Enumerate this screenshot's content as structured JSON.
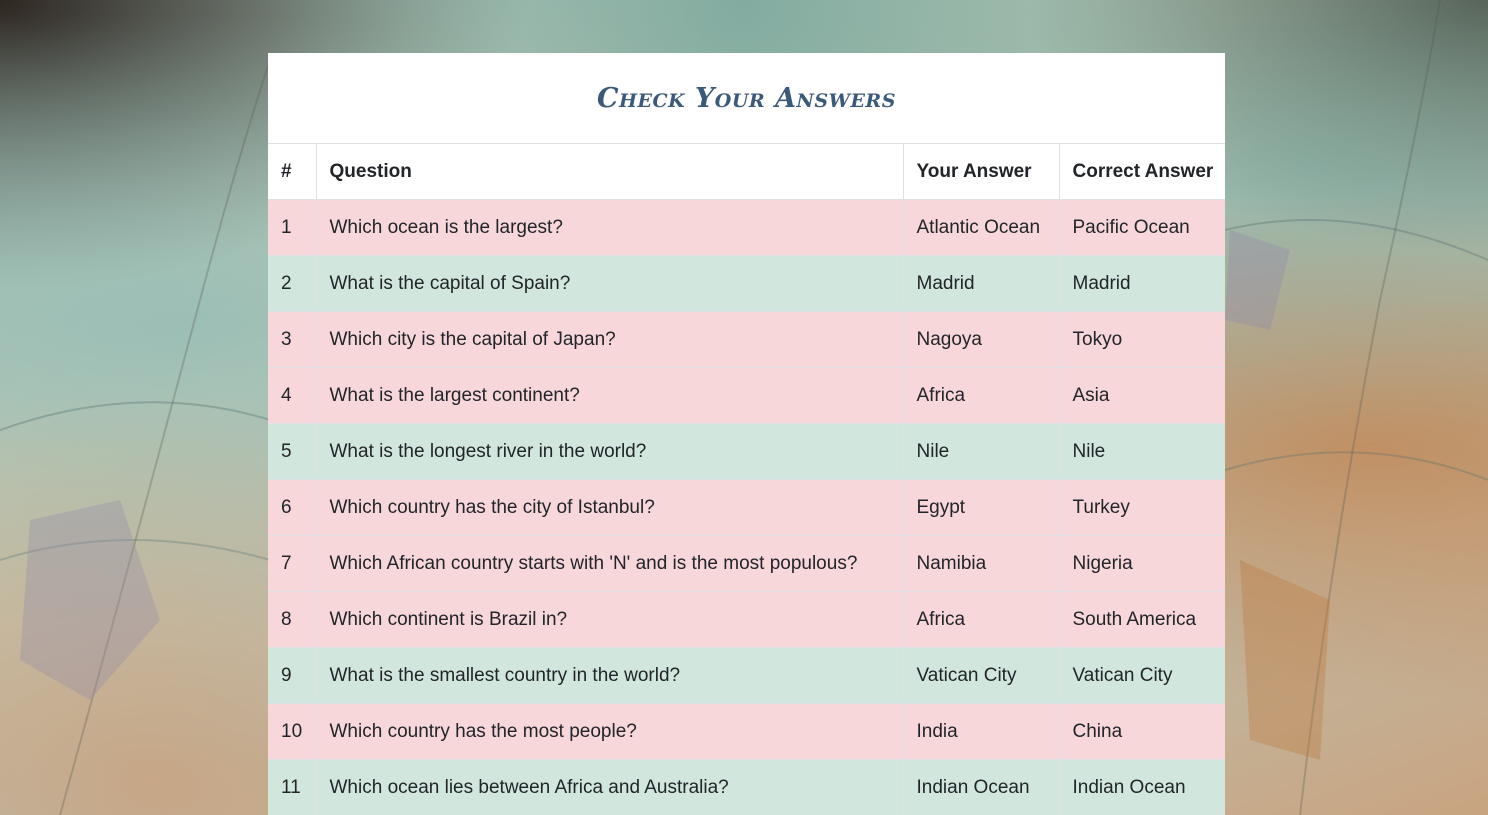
{
  "page": {
    "title": "Check Your Answers"
  },
  "table": {
    "headers": {
      "num": "#",
      "question": "Question",
      "your_answer": "Your Answer",
      "correct_answer": "Correct Answer"
    },
    "rows": [
      {
        "num": "1",
        "question": "Which ocean is the largest?",
        "your_answer": "Atlantic Ocean",
        "correct_answer": "Pacific Ocean",
        "status": "incorrect"
      },
      {
        "num": "2",
        "question": "What is the capital of Spain?",
        "your_answer": "Madrid",
        "correct_answer": "Madrid",
        "status": "correct"
      },
      {
        "num": "3",
        "question": "Which city is the capital of Japan?",
        "your_answer": "Nagoya",
        "correct_answer": "Tokyo",
        "status": "incorrect"
      },
      {
        "num": "4",
        "question": "What is the largest continent?",
        "your_answer": "Africa",
        "correct_answer": "Asia",
        "status": "incorrect"
      },
      {
        "num": "5",
        "question": "What is the longest river in the world?",
        "your_answer": "Nile",
        "correct_answer": "Nile",
        "status": "correct"
      },
      {
        "num": "6",
        "question": "Which country has the city of Istanbul?",
        "your_answer": "Egypt",
        "correct_answer": "Turkey",
        "status": "incorrect"
      },
      {
        "num": "7",
        "question": "Which African country starts with 'N' and is the most populous?",
        "your_answer": "Namibia",
        "correct_answer": "Nigeria",
        "status": "incorrect"
      },
      {
        "num": "8",
        "question": "Which continent is Brazil in?",
        "your_answer": "Africa",
        "correct_answer": "South America",
        "status": "incorrect"
      },
      {
        "num": "9",
        "question": "What is the smallest country in the world?",
        "your_answer": "Vatican City",
        "correct_answer": "Vatican City",
        "status": "correct"
      },
      {
        "num": "10",
        "question": "Which country has the most people?",
        "your_answer": "India",
        "correct_answer": "China",
        "status": "incorrect"
      },
      {
        "num": "11",
        "question": "Which ocean lies between Africa and Australia?",
        "your_answer": "Indian Ocean",
        "correct_answer": "Indian Ocean",
        "status": "correct"
      }
    ]
  },
  "colors": {
    "correct_row": "#d1e7dd",
    "incorrect_row": "#f8d7da",
    "title": "#3b5a7a"
  }
}
